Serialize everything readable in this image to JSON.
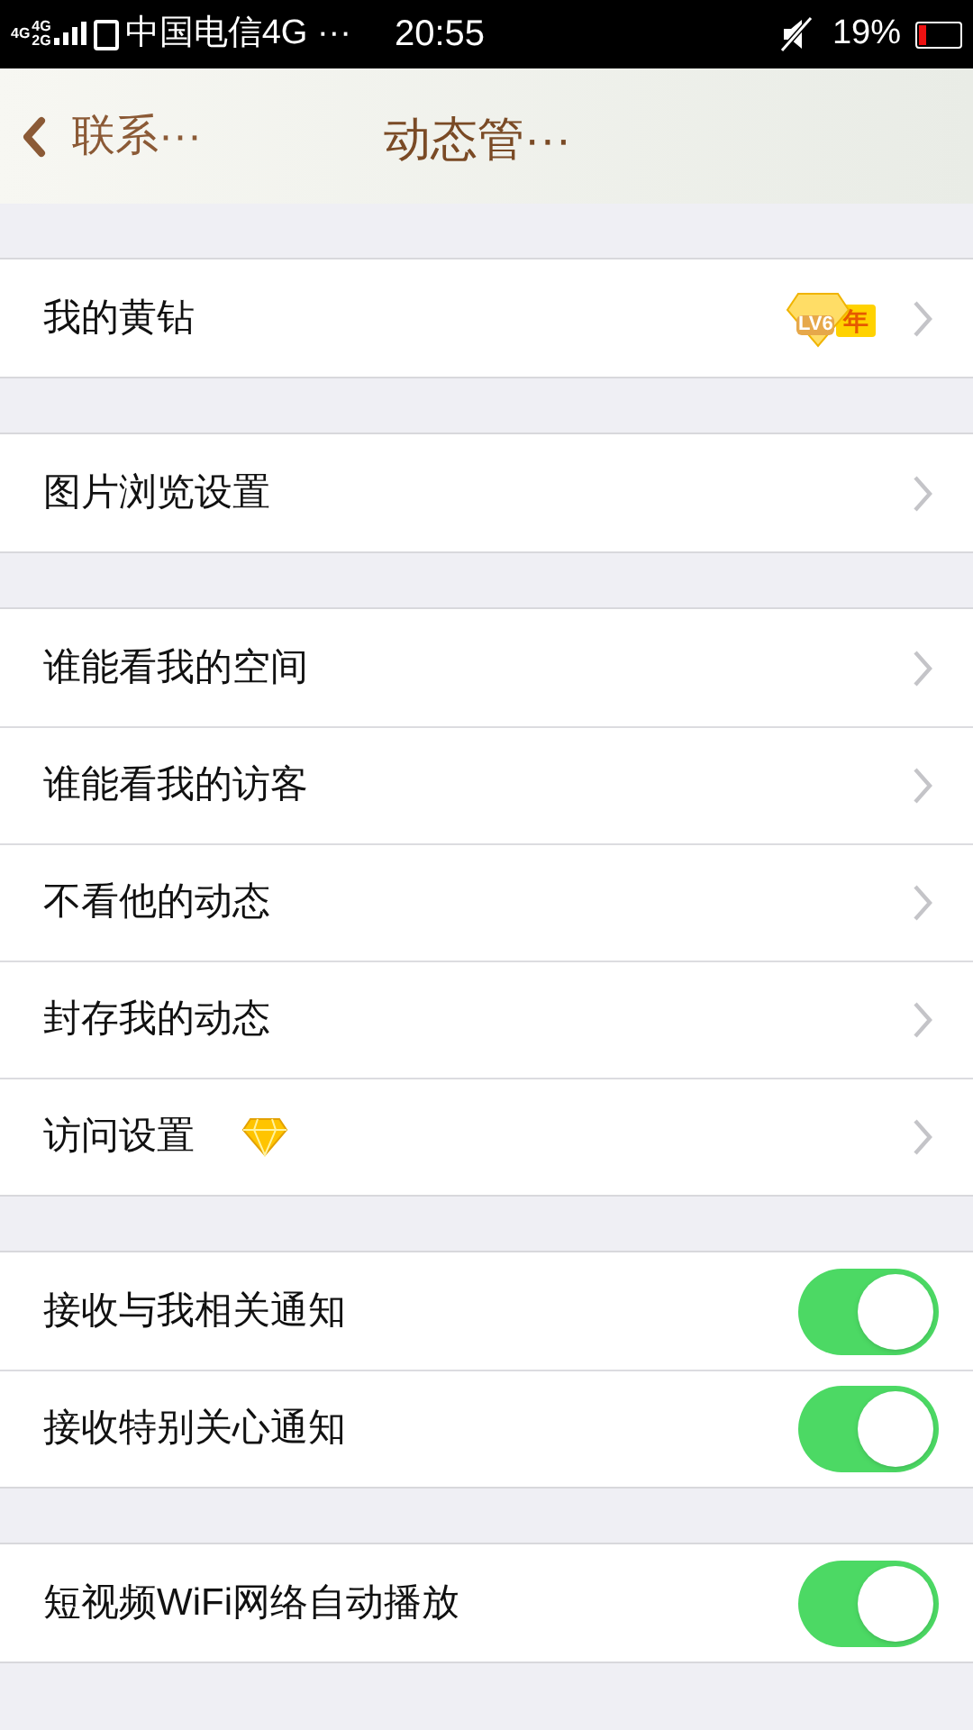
{
  "status_bar": {
    "network_labels": [
      "4G",
      "4G",
      "2G"
    ],
    "carrier": "中国电信4G ···",
    "time": "20:55",
    "battery": "19%"
  },
  "header": {
    "back_label": "联系···",
    "title": "动态管···"
  },
  "sections": [
    {
      "rows": [
        {
          "kind": "nav",
          "label": "我的黄钻",
          "badge": {
            "level": "LV6",
            "tag": "年"
          }
        }
      ]
    },
    {
      "rows": [
        {
          "kind": "nav",
          "label": "图片浏览设置"
        }
      ]
    },
    {
      "rows": [
        {
          "kind": "nav",
          "label": "谁能看我的空间"
        },
        {
          "kind": "nav",
          "label": "谁能看我的访客"
        },
        {
          "kind": "nav",
          "label": "不看他的动态"
        },
        {
          "kind": "nav",
          "label": "封存我的动态"
        },
        {
          "kind": "nav",
          "label": "访问设置",
          "diamond": true
        }
      ]
    },
    {
      "rows": [
        {
          "kind": "toggle",
          "label": "接收与我相关通知",
          "on": true
        },
        {
          "kind": "toggle",
          "label": "接收特别关心通知",
          "on": true
        }
      ]
    },
    {
      "rows": [
        {
          "kind": "toggle",
          "label": "短视频WiFi网络自动播放",
          "on": true
        }
      ]
    }
  ]
}
